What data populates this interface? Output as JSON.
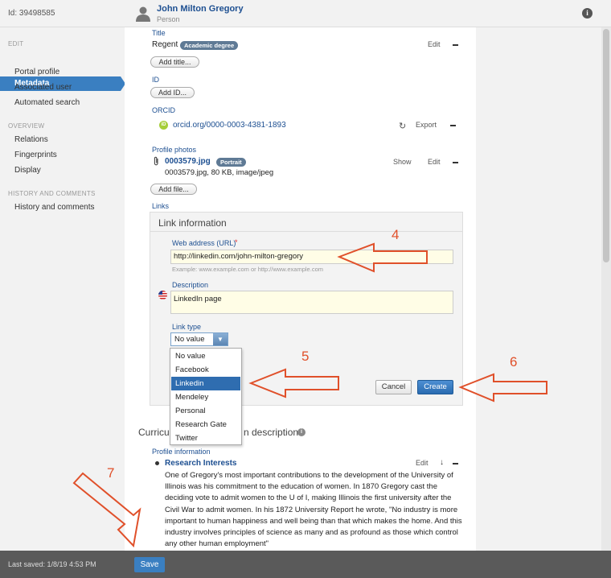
{
  "header": {
    "id_label": "Id: 39498585",
    "person_name": "John Milton Gregory",
    "person_type": "Person"
  },
  "sidebar": {
    "edit_heading": "EDIT",
    "edit_items": [
      "Metadata",
      "Portal profile",
      "Associated user",
      "Automated search"
    ],
    "overview_heading": "OVERVIEW",
    "overview_items": [
      "Relations",
      "Fingerprints",
      "Display"
    ],
    "history_heading": "HISTORY AND COMMENTS",
    "history_items": [
      "History and comments"
    ]
  },
  "title_section": {
    "label": "Title",
    "value": "Regent",
    "badge": "Academic degree",
    "edit": "Edit",
    "add_button": "Add title..."
  },
  "id_section": {
    "label": "ID",
    "add_button": "Add ID..."
  },
  "orcid_section": {
    "label": "ORCID",
    "icon_text": "iD",
    "link": "orcid.org/0000-0003-4381-1893",
    "export": "Export"
  },
  "photos_section": {
    "label": "Profile photos",
    "file_link": "0003579.jpg",
    "badge": "Portrait",
    "file_info": "0003579.jpg, 80 KB, image/jpeg",
    "show": "Show",
    "edit": "Edit",
    "add_button": "Add file..."
  },
  "links_section": {
    "label": "Links"
  },
  "link_info": {
    "heading": "Link information",
    "url_label": "Web address (URL)",
    "required_mark": "*",
    "url_value": "http://linkedin.com/john-milton-gregory",
    "url_hint": "Example: www.example.com or http://www.example.com",
    "description_label": "Description",
    "description_value": "LinkedIn page",
    "link_type_label": "Link type",
    "link_type_selected": "No value",
    "dropdown_options": [
      "No value",
      "Facebook",
      "Linkedin",
      "Mendeley",
      "Personal",
      "Research Gate",
      "Twitter"
    ],
    "dropdown_highlighted": "Linkedin",
    "cancel": "Cancel",
    "create": "Create"
  },
  "cv_section": {
    "heading_left": "Curricu",
    "heading_right": "n description",
    "profile_info_label": "Profile information",
    "item_title": "Research Interests",
    "edit": "Edit",
    "paragraph": "One of Gregory's most important contributions to the development of the University of Illinois was his commitment to the education of women. In 1870 Gregory cast the deciding vote to admit women to the U of I, making Illinois the first university after the Civil War to admit women. In his 1872 University Report he wrote, \"No industry is more important to human happiness and well being than that which makes the home. And this industry involves principles of science as many and as profound as those which control any other human employment\""
  },
  "footer": {
    "last_saved": "Last saved: 1/8/19 4:53 PM",
    "save": "Save"
  },
  "annotations": {
    "n4": "4",
    "n5": "5",
    "n6": "6",
    "n7": "7",
    "arrow_color": "#e0502a"
  },
  "colors": {
    "accent": "#3a7fc1",
    "link": "#1d4f91",
    "highlight": "#2f6db0",
    "field_bg": "#fffde6"
  }
}
